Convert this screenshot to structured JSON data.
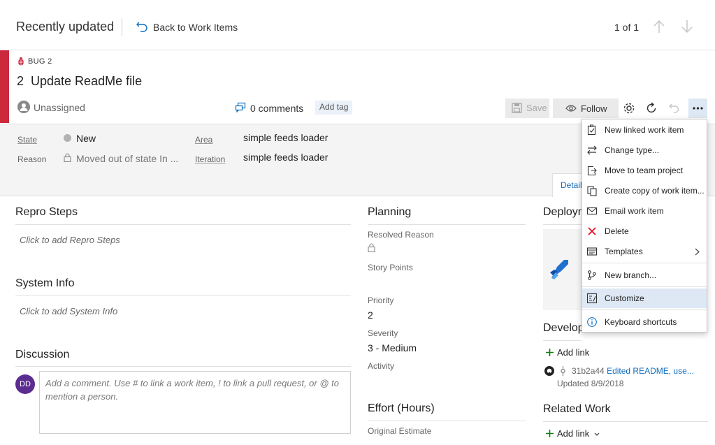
{
  "header": {
    "title": "Recently updated",
    "back_label": "Back to Work Items",
    "pager": "1 of 1"
  },
  "work_item": {
    "type_label": "BUG 2",
    "id": "2",
    "title": "Update ReadMe file",
    "assignee": "Unassigned",
    "comments": "0 comments",
    "add_tag": "Add tag",
    "accent_color": "#cc293d"
  },
  "toolbar": {
    "save_label": "Save",
    "follow_label": "Follow"
  },
  "fields": {
    "state_label": "State",
    "state_value": "New",
    "reason_label": "Reason",
    "reason_value": "Moved out of state In ...",
    "area_label": "Area",
    "area_value": "simple feeds loader",
    "iteration_label": "Iteration",
    "iteration_value": "simple feeds loader",
    "details_tab": "Detail"
  },
  "left": {
    "repro_title": "Repro Steps",
    "repro_placeholder": "Click to add Repro Steps",
    "sysinfo_title": "System Info",
    "sysinfo_placeholder": "Click to add System Info",
    "discussion_title": "Discussion",
    "avatar_initials": "DD",
    "comment_placeholder": "Add a comment. Use # to link a work item, ! to link a pull request, or @ to mention a person."
  },
  "planning": {
    "title": "Planning",
    "resolved_reason_label": "Resolved Reason",
    "story_points_label": "Story Points",
    "priority_label": "Priority",
    "priority_value": "2",
    "severity_label": "Severity",
    "severity_value": "3 - Medium",
    "activity_label": "Activity",
    "effort_title": "Effort (Hours)",
    "original_estimate_label": "Original Estimate"
  },
  "right": {
    "deploy_title": "Deploym",
    "develop_title": "Develop",
    "add_link": "Add link",
    "commit_hash": "31b2a44",
    "commit_message": "Edited README, use...",
    "commit_updated": "Updated 8/9/2018",
    "related_title": "Related Work",
    "related_add_link": "Add link"
  },
  "menu": {
    "items": [
      {
        "label": "New linked work item",
        "icon": "new-linked-icon"
      },
      {
        "label": "Change type...",
        "icon": "change-type-icon"
      },
      {
        "label": "Move to team project",
        "icon": "move-project-icon"
      },
      {
        "label": "Create copy of work item...",
        "icon": "copy-icon"
      },
      {
        "label": "Email work item",
        "icon": "email-icon"
      },
      {
        "label": "Delete",
        "icon": "delete-icon"
      },
      {
        "label": "Templates",
        "icon": "templates-icon"
      },
      {
        "label": "New branch...",
        "icon": "branch-icon"
      },
      {
        "label": "Customize",
        "icon": "customize-icon"
      },
      {
        "label": "Keyboard shortcuts",
        "icon": "info-icon"
      }
    ]
  }
}
